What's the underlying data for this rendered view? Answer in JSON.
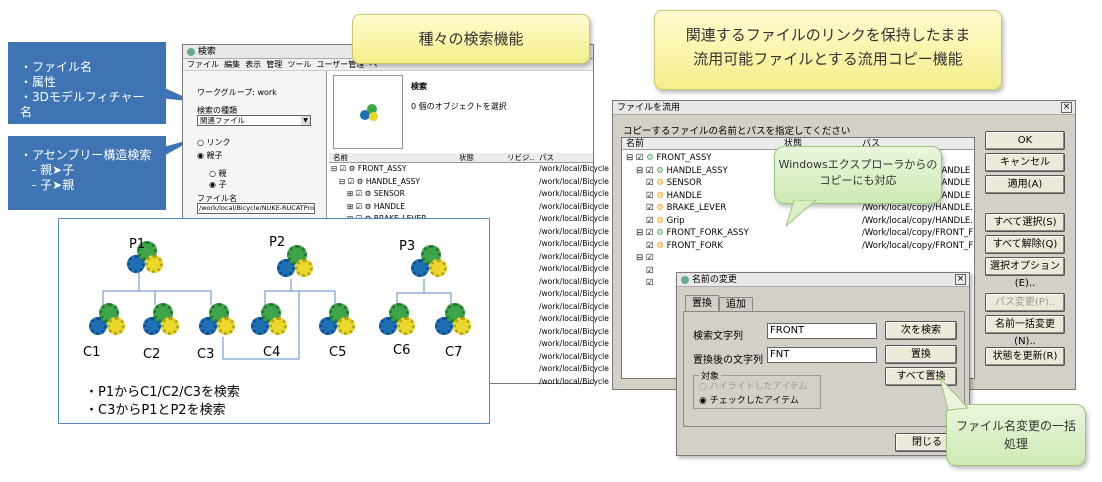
{
  "callouts": {
    "search_title": "種々の検索機能",
    "copy_title_line1": "関連するファイルのリンクを保持したまま",
    "copy_title_line2": "流用可能ファイルとする流用コピー機能",
    "blue1": [
      "・ファイル名",
      "・属性",
      "・3Dモデルフィチャー名"
    ],
    "blue2": [
      "・アセンブリー構造検索",
      "　- 親➤子",
      "　- 子➤親"
    ],
    "explorer_line1": "Windowsエクスプローラからの",
    "explorer_line2": "コピーにも対応",
    "rename_line1": "ファイル名変更の一括",
    "rename_line2": "処理"
  },
  "search_window": {
    "title": "検索",
    "menu": [
      "ファイル",
      "編集",
      "表示",
      "管理",
      "ツール",
      "ユーザー管理",
      "ヘ"
    ],
    "workgroup": "ワークグループ: work",
    "search_type_label": "検索の種類",
    "search_type_value": "関連ファイル",
    "radio_link": "リンク",
    "radio_parentchild": "親子",
    "radio_parent": "親",
    "radio_child": "子",
    "filename_label": "ファイル名",
    "filename_value": "/work/local/Bicycle/NUKE-RUCATProd",
    "panel_title": "検索",
    "panel_status": "0 個のオブジェクトを選択",
    "columns": [
      "名前",
      "状態",
      "リビジ..",
      "パス"
    ],
    "rows": [
      {
        "name": "FRONT_ASSY",
        "path": "/work/local/Bicycle"
      },
      {
        "name": "HANDLE_ASSY",
        "path": "/work/local/Bicycle"
      },
      {
        "name": "SENSOR",
        "path": "/work/local/Bicycle"
      },
      {
        "name": "HANDLE",
        "path": "/work/local/Bicycle"
      },
      {
        "name": "BRAKE_LEVER",
        "path": "/work/local/Bicycle"
      }
    ],
    "extra_paths": [
      "/work/local/Bicycle",
      "/work/local/Bicycle",
      "/work/local/Bicycle",
      "/work/local/Bicycle",
      "/work/local/Bicycle",
      "/work/local/Bicycle",
      "/work/local/Bicycle",
      "/work/local/Bicycle",
      "/work/local/Bicycle",
      "/work/local/Bicycle",
      "/work/local/Bicycle",
      "/work/local/Bicycle",
      "/work/local/Bicycle"
    ]
  },
  "diagram": {
    "labels": {
      "p1": "P1",
      "p2": "P2",
      "p3": "P3",
      "c1": "C1",
      "c2": "C2",
      "c3": "C3",
      "c4": "C4",
      "c5": "C5",
      "c6": "C6",
      "c7": "C7"
    },
    "note1": "・P1からC1/C2/C3を検索",
    "note2": "・C3からP1とP2を検索"
  },
  "copy_window": {
    "title": "ファイルを流用",
    "instruction": "コピーするファイルの名前とパスを指定してください",
    "columns": [
      "名前",
      "状態",
      "パス"
    ],
    "rows": [
      {
        "name": "FRONT_ASSY",
        "path": ""
      },
      {
        "name": "HANDLE_ASSY",
        "path": "/Work/local/copy/HANDLE"
      },
      {
        "name": "SENSOR",
        "path": "/Work/local/copy/HANDLE"
      },
      {
        "name": "HANDLE",
        "path": "/Work/local/copy/HANDLE"
      },
      {
        "name": "BRAKE_LEVER",
        "path": "/Work/local/copy/HANDLE."
      },
      {
        "name": "Grip",
        "path": "/Work/local/copy/HANDLE."
      },
      {
        "name": "FRONT_FORK_ASSY",
        "path": "/Work/local/copy/FRONT_F"
      },
      {
        "name": "FRONT_FORK",
        "path": "/Work/local/copy/FRONT_F"
      }
    ],
    "buttons": {
      "ok": "OK",
      "cancel": "キャンセル",
      "apply": "適用(A)",
      "select_all": "すべて選択(S)",
      "deselect_all": "すべて解除(Q)",
      "select_options": "選択オプション(E)..",
      "path_change": "パス変更(P)..",
      "bulk_rename": "名前一括変更(N)..",
      "update_status": "状態を更新(R)"
    }
  },
  "rename_dialog": {
    "title": "名前の変更",
    "tab_replace": "置換",
    "tab_add": "追加",
    "search_label": "検索文字列",
    "search_value": "FRONT",
    "replace_label": "置換後の文字列",
    "replace_value": "FNT",
    "find_next": "次を検索",
    "replace": "置換",
    "replace_all": "すべて置換",
    "target_label": "対象",
    "radio_highlight": "ハイライトしたアイテム",
    "radio_checked": "チェックしたアイテム",
    "close": "閉じる"
  }
}
